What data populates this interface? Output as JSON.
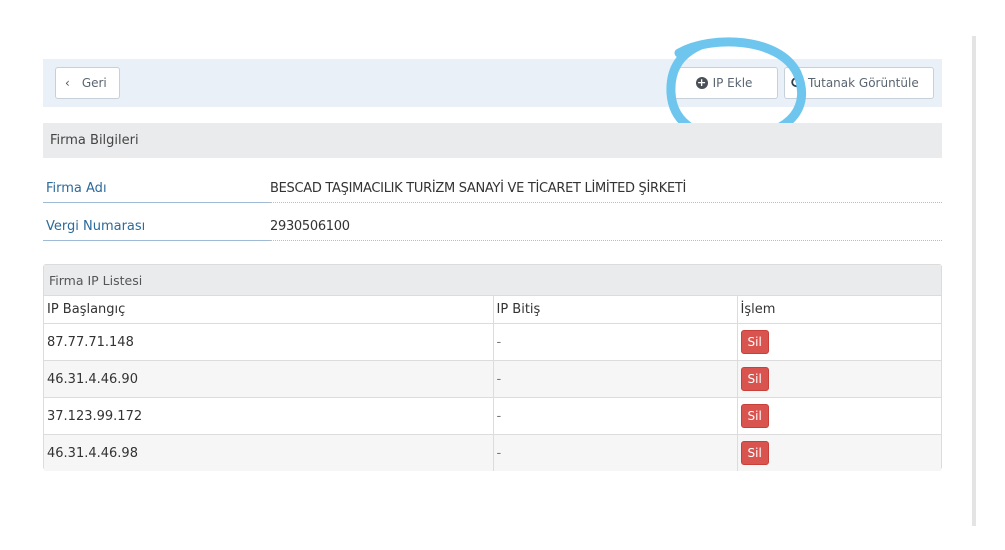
{
  "toolbar": {
    "back_label": "Geri",
    "add_ip_label": "IP Ekle",
    "report_label": "Tutanak Görüntüle"
  },
  "company_section": {
    "title": "Firma Bilgileri",
    "fields": [
      {
        "label": "Firma Adı",
        "value": "BESCAD TAŞIMACILIK TURİZM SANAYİ VE TİCARET LİMİTED ŞİRKETİ"
      },
      {
        "label": "Vergi Numarası",
        "value": "2930506100"
      }
    ]
  },
  "ip_list": {
    "title": "Firma IP Listesi",
    "columns": [
      "IP Başlangıç",
      "IP Bitiş",
      "İşlem"
    ],
    "rows": [
      {
        "start": "87.77.71.148",
        "end": "-",
        "action": "Sil"
      },
      {
        "start": "46.31.4.46.90",
        "end": "-",
        "action": "Sil"
      },
      {
        "start": "37.123.99.172",
        "end": "-",
        "action": "Sil"
      },
      {
        "start": "46.31.4.46.98",
        "end": "-",
        "action": "Sil"
      }
    ]
  },
  "colors": {
    "toolbar_bg": "#e9f0f7",
    "label_blue": "#2c6a9b",
    "delete_red": "#d9534f",
    "annotation_blue": "#6ec6ef"
  },
  "icons": {
    "back": "chevron-left-icon",
    "add": "plus-circle-icon",
    "report": "search-icon"
  }
}
